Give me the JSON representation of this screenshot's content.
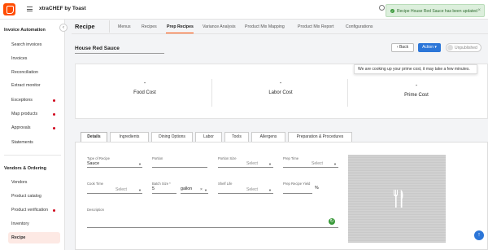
{
  "header": {
    "brand": "xtraCHEF by Toast",
    "toast_message": "Recipe House Red Sauce has been updated",
    "toast_close": "×"
  },
  "sidebar": {
    "collapse_glyph": "‹",
    "group1": "Invoice Automation",
    "group1_items": [
      {
        "label": "Search invoices",
        "dot": false
      },
      {
        "label": "Invoices",
        "dot": false
      },
      {
        "label": "Reconciliation",
        "dot": false
      },
      {
        "label": "Extract monitor",
        "dot": false
      },
      {
        "label": "Exceptions",
        "dot": true
      },
      {
        "label": "Map products",
        "dot": true
      },
      {
        "label": "Approvals",
        "dot": true
      },
      {
        "label": "Statements",
        "dot": false
      }
    ],
    "group2": "Vendors & Ordering",
    "group2_items": [
      {
        "label": "Vendors",
        "dot": false
      },
      {
        "label": "Product catalog",
        "dot": false
      },
      {
        "label": "Product verification",
        "dot": true
      },
      {
        "label": "Inventory",
        "dot": false
      },
      {
        "label": "Recipe",
        "dot": false,
        "active": true
      }
    ]
  },
  "page": {
    "title": "Recipe",
    "nav_tabs": [
      "Menus",
      "Recipes",
      "Prep Recipes",
      "Variance Analysis",
      "Product Mix Mapping",
      "Product Mix Report",
      "Configurations"
    ],
    "active_tab": "Prep Recipes",
    "recipe_name": "House Red Sauce",
    "back_label": "‹ Back",
    "action_label": "Action ▾",
    "publish_state": "Unpublished"
  },
  "cost": {
    "tooltip": "We are cooking up your prime cost, it may take a few minutes.",
    "columns": [
      {
        "value": "-",
        "label": "Food Cost"
      },
      {
        "value": "-",
        "label": "Labor Cost"
      },
      {
        "value": "-",
        "label": "Prime Cost"
      }
    ]
  },
  "details": {
    "tabs": [
      "Details",
      "Ingredients",
      "Dining Options",
      "Labor",
      "Tools",
      "Allergens",
      "Preparation & Procedures"
    ],
    "active_tab": "Details",
    "fields": {
      "type_label": "Type of Recipe",
      "type_value": "Sauce",
      "portion_label": "Portion",
      "portion_size_label": "Portion Size",
      "portion_size_value": "Select",
      "prep_time_label": "Prep Time",
      "prep_time_value": "Select",
      "cook_time_label": "Cook Time",
      "cook_time_value": "Select",
      "batch_size_label": "Batch Size *",
      "batch_size_value": "5",
      "batch_unit": "gallon",
      "shelf_life_label": "Shelf Life",
      "shelf_life_value": "Select",
      "yield_label": "Prep Recipe Yield",
      "yield_unit": "%",
      "description_label": "Description"
    }
  },
  "icons": {
    "refresh": "refresh-icon",
    "scroll_top": "arrow-up-icon",
    "utensils": "utensils-icon"
  },
  "colors": {
    "brand": "#ff4c00",
    "primary": "#2c76d8",
    "success_bg": "#dcefdc",
    "active_nav_bg": "#fde9e4"
  }
}
